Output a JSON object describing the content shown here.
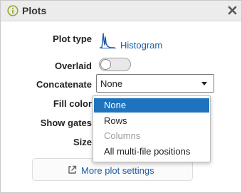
{
  "panel": {
    "title": "Plots",
    "info_icon": "info-circle-icon",
    "close_icon": "close-x-icon"
  },
  "fields": {
    "plot_type": {
      "label": "Plot type",
      "value": "Histogram",
      "icon": "histogram-icon"
    },
    "overlaid": {
      "label": "Overlaid",
      "checked": false
    },
    "concatenate": {
      "label": "Concatenate",
      "value": "None"
    },
    "fill_color": {
      "label": "Fill color"
    },
    "show_gates": {
      "label": "Show gates"
    },
    "size": {
      "label": "Size"
    }
  },
  "dropdown": {
    "options": [
      {
        "label": "None",
        "state": "selected"
      },
      {
        "label": "Rows",
        "state": "enabled"
      },
      {
        "label": "Columns",
        "state": "disabled"
      },
      {
        "label": "All multi-file positions",
        "state": "enabled"
      }
    ]
  },
  "more_button": {
    "label": "More plot settings",
    "icon": "external-link-icon"
  },
  "colors": {
    "accent_link": "#1d5aa6",
    "selected_bg": "#1e73be",
    "info_icon": "#9aa62b",
    "titlebar_bg": "#ececec"
  }
}
